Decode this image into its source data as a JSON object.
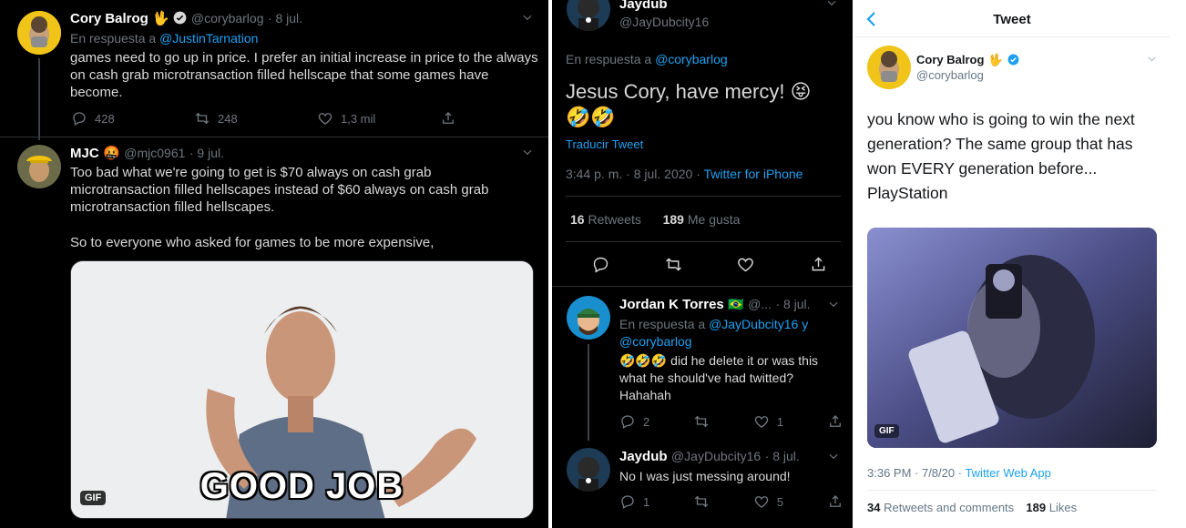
{
  "left": {
    "tweet1": {
      "name": "Cory Balrog",
      "name_emoji": "🖖",
      "handle": "@corybarlog",
      "date": "· 8 jul.",
      "reply_prefix": "En respuesta a ",
      "reply_to": "@JustinTarnation",
      "text": "games need to go up in price. I prefer an initial increase in price to the always on cash grab microtransaction filled hellscape that some games have become.",
      "replies": "428",
      "retweets": "248",
      "likes": "1,3 mil"
    },
    "tweet2": {
      "name": "MJC",
      "name_emoji": "🤬",
      "handle": "@mjc0961",
      "date": "· 9 jul.",
      "text1": "Too bad what we're going to get is $70 always on cash grab microtransaction filled hellscapes instead of $60 always on cash grab microtransaction filled hellscapes.",
      "text2": "So to everyone who asked for games to be more expensive,",
      "gif_caption": "GOOD JOB",
      "gif_badge": "GIF"
    }
  },
  "middle": {
    "main": {
      "name": "Jaydub",
      "handle": "@JayDubcity16",
      "reply_prefix": "En respuesta a ",
      "reply_to": "@corybarlog",
      "text": "Jesus Cory, have mercy! 😝",
      "emojis": "🤣🤣😂",
      "translate": "Traducir Tweet",
      "timestamp": "3:44 p. m. · 8 jul. 2020 · ",
      "source": "Twitter for iPhone",
      "retweets_count": "16",
      "retweets_label": "Retweets",
      "likes_count": "189",
      "likes_label": "Me gusta"
    },
    "reply1": {
      "name": "Jordan K Torres",
      "name_emoji": "🇧🇷",
      "handle": "@...",
      "date": "· 8 jul.",
      "reply_prefix": "En respuesta a ",
      "reply_to": "@JayDubcity16",
      "reply_join": " y",
      "reply_to2": "@corybarlog",
      "text_line1": "🤣🤣🤣 did he delete it or was this",
      "text_line2": "what he should've had twitted?",
      "text_line3": "Hahahah",
      "replies": "2",
      "likes": "1"
    },
    "reply2": {
      "name": "Jaydub",
      "handle": "@JayDubcity16",
      "date": "· 8 jul.",
      "text": "No I was just messing around!",
      "replies": "1",
      "likes": "5"
    }
  },
  "right": {
    "header_title": "Tweet",
    "name": "Cory Balrog",
    "name_emoji": "🖖",
    "handle": "@corybarlog",
    "text": "you know who is going to win the next generation? The same group that has won EVERY generation before... PlayStation",
    "gif_badge": "GIF",
    "timestamp": "3:36 PM · 7/8/20 · ",
    "source": "Twitter Web App",
    "retweets_count": "34",
    "retweets_label": "Retweets and comments",
    "likes_count": "189",
    "likes_label": "Likes"
  },
  "colors": {
    "accent": "#1da1f2",
    "dark_bg": "#000000",
    "dark_text": "#d9d9d9",
    "muted": "#6e767d",
    "verified": "#1da1f2"
  }
}
